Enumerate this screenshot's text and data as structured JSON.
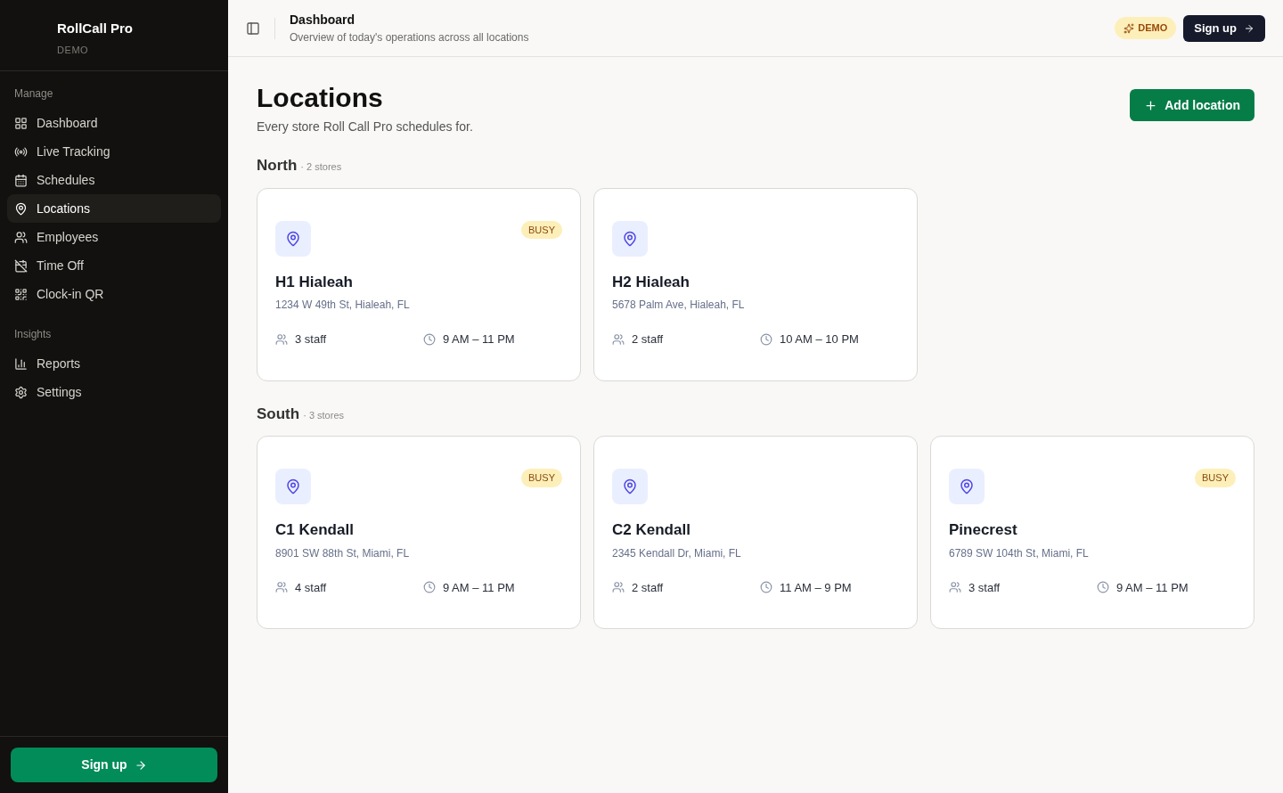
{
  "sidebar": {
    "brand": "RollCall Pro",
    "brand_sub": "DEMO",
    "sections": [
      {
        "title": "Manage",
        "items": [
          {
            "label": "Dashboard",
            "selected": false
          },
          {
            "label": "Live Tracking",
            "selected": false
          },
          {
            "label": "Schedules",
            "selected": false
          },
          {
            "label": "Locations",
            "selected": true
          },
          {
            "label": "Employees",
            "selected": false
          },
          {
            "label": "Time Off",
            "selected": false
          },
          {
            "label": "Clock-in QR",
            "selected": false
          }
        ]
      },
      {
        "title": "Insights",
        "items": [
          {
            "label": "Reports",
            "selected": false
          },
          {
            "label": "Settings",
            "selected": false
          }
        ]
      }
    ],
    "signup": "Sign up"
  },
  "header": {
    "title": "Dashboard",
    "subtitle": "Overview of today's operations across all locations",
    "badge": "DEMO",
    "signup": "Sign up"
  },
  "page": {
    "title": "Locations",
    "subtitle": "Every store Roll Call Pro schedules for.",
    "add_button": "Add location",
    "groups": [
      {
        "name": "North",
        "count": "· 2 stores",
        "locations": [
          {
            "name": "H1 Hialeah",
            "address": "1234 W 49th St, Hialeah, FL",
            "staff": "3 staff",
            "hours": "9 AM – 11 PM",
            "busy": true,
            "badge": "BUSY"
          },
          {
            "name": "H2 Hialeah",
            "address": "5678 Palm Ave, Hialeah, FL",
            "staff": "2 staff",
            "hours": "10 AM – 10 PM",
            "busy": false
          }
        ]
      },
      {
        "name": "South",
        "count": "· 3 stores",
        "locations": [
          {
            "name": "C1 Kendall",
            "address": "8901 SW 88th St, Miami, FL",
            "staff": "4 staff",
            "hours": "9 AM – 11 PM",
            "busy": true,
            "badge": "BUSY"
          },
          {
            "name": "C2 Kendall",
            "address": "2345 Kendall Dr, Miami, FL",
            "staff": "2 staff",
            "hours": "11 AM – 9 PM",
            "busy": false
          },
          {
            "name": "Pinecrest",
            "address": "6789 SW 104th St, Miami, FL",
            "staff": "3 staff",
            "hours": "9 AM – 11 PM",
            "busy": true,
            "badge": "BUSY"
          }
        ]
      }
    ]
  }
}
